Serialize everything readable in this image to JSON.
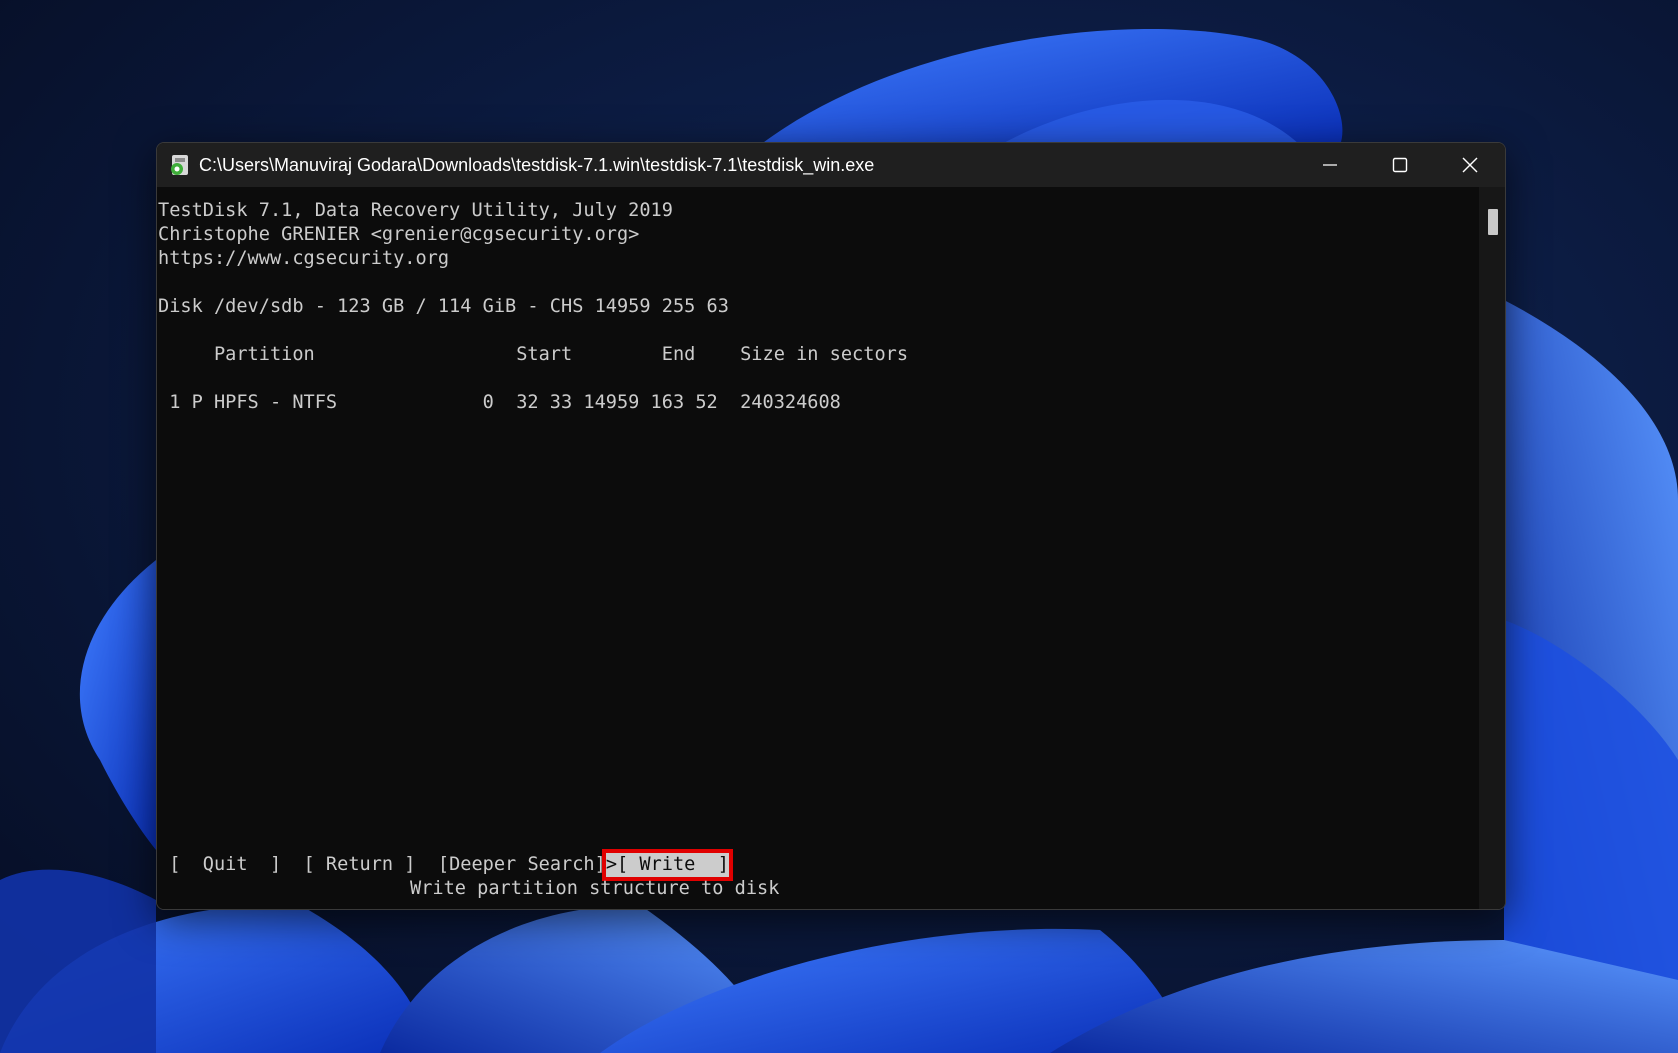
{
  "window": {
    "title": "C:\\Users\\Manuviraj Godara\\Downloads\\testdisk-7.1.win\\testdisk-7.1\\testdisk_win.exe",
    "controls": [
      "minimize-icon",
      "maximize-icon",
      "close-icon"
    ]
  },
  "console": {
    "header_line1": "TestDisk 7.1, Data Recovery Utility, July 2019",
    "header_line2": "Christophe GRENIER <grenier@cgsecurity.org>",
    "header_line3": "https://www.cgsecurity.org",
    "disk_line": "Disk /dev/sdb - 123 GB / 114 GiB - CHS 14959 255 63",
    "table_header": "     Partition                  Start        End    Size in sectors",
    "partition_row": " 1 P HPFS - NTFS             0  32 33 14959 163 52  240324608"
  },
  "menu": {
    "quit": "[  Quit  ]",
    "return": "[ Return ]",
    "deeper_search": "[Deeper Search]",
    "write": ">[ Write  ]",
    "hint": "Write partition structure to disk"
  },
  "colors": {
    "console_bg": "#0c0c0c",
    "console_text": "#cccccc",
    "highlight_border": "#e00000"
  }
}
